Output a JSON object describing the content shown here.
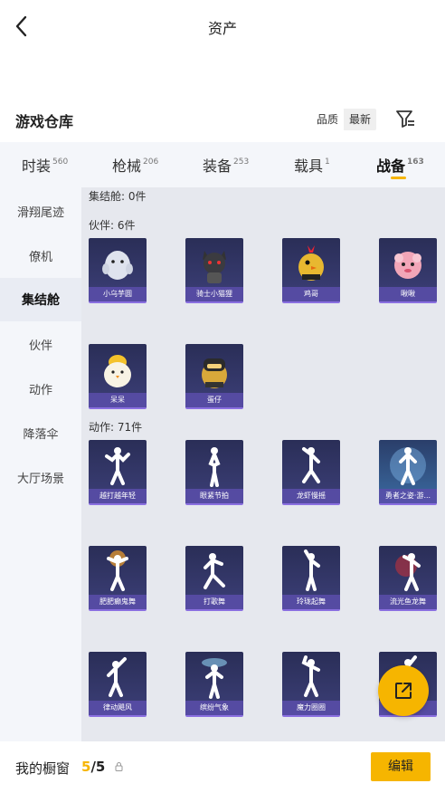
{
  "header": {
    "title": "资产"
  },
  "warehouse": {
    "title": "游戏仓库",
    "sort_options": [
      "品质",
      "最新"
    ],
    "active_sort": "最新"
  },
  "tabs": [
    {
      "label": "时装",
      "count": "560"
    },
    {
      "label": "枪械",
      "count": "206"
    },
    {
      "label": "装备",
      "count": "253"
    },
    {
      "label": "载具",
      "count": "1"
    },
    {
      "label": "战备",
      "count": "163",
      "active": true
    }
  ],
  "sidebar": {
    "items": [
      "滑翔尾迹",
      "僚机",
      "集结舱",
      "伙伴",
      "动作",
      "降落伞",
      "大厅场景"
    ],
    "active": "集结舱"
  },
  "sections": {
    "pods": {
      "label": "集结舱: 0件"
    },
    "companions": {
      "label": "伙伴: 6件",
      "items": [
        "小乌芋圆",
        "骑士小猫狸",
        "鸡哥",
        "啾啾",
        "呆呆",
        "蛋仔"
      ]
    },
    "emotes": {
      "label": "动作: 71件",
      "items": [
        "越打越年轻",
        "眼紧节拍",
        "龙虾慢摇",
        "勇者之姿·游...",
        "肥肥癫鬼舞",
        "打歌舞",
        "玲珑起舞",
        "流光鱼龙舞",
        "律动飓风",
        "缤纷气象",
        "魔力圈圈",
        ""
      ]
    }
  },
  "bottom": {
    "window_label": "我的橱窗",
    "count_current": "5",
    "count_total": "/5",
    "edit_label": "编辑"
  },
  "colors": {
    "accent": "#f6b500",
    "card_bg": "#2a2e57",
    "card_caption": "#5a4eaa"
  },
  "icons": [
    "back-arrow-icon",
    "filter-icon",
    "lock-icon",
    "share-icon"
  ]
}
